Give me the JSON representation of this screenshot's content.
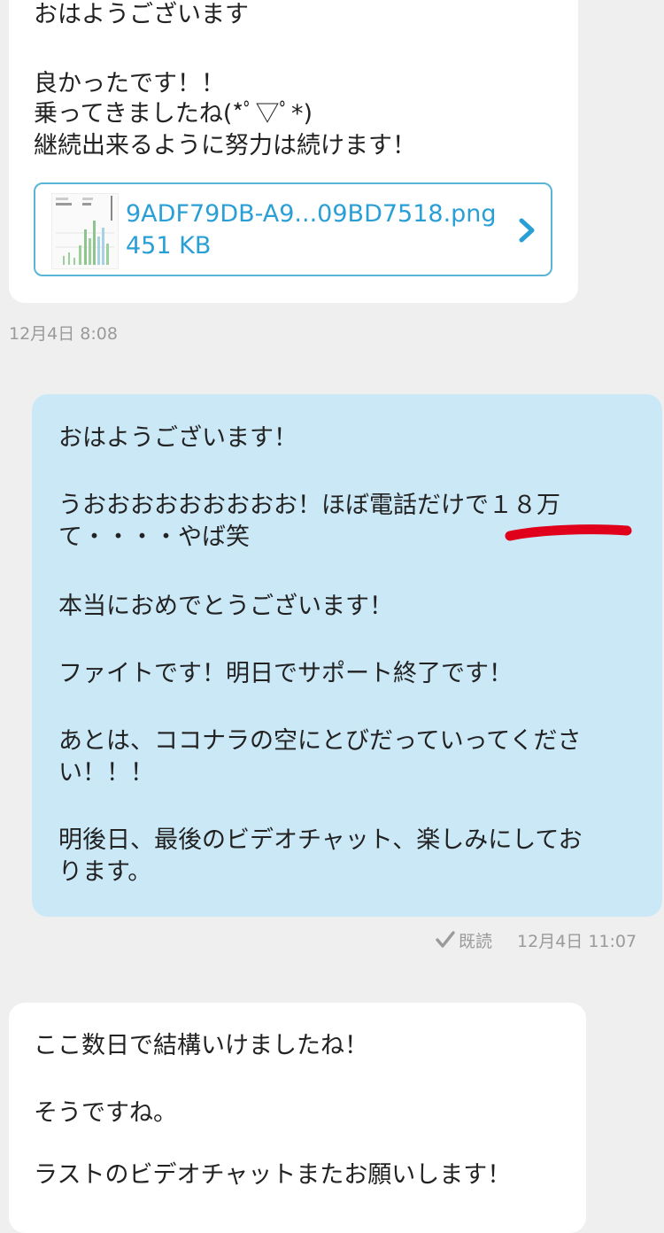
{
  "messages": [
    {
      "direction": "received",
      "lines": [
        "おはようございます",
        "",
        "良かったです！！",
        "乗ってきましたね(*ﾟ▽ﾟ*)",
        "継続出来るように努力は続けます！"
      ],
      "attachment": {
        "filename": "9ADF79DB-A9...09BD7518.png",
        "size": "451 KB",
        "icon": "chevron-right-icon"
      },
      "timestamp": "12月4日 8:08"
    },
    {
      "direction": "sent",
      "lines": [
        "おはようございます！",
        "",
        "うおおおおおおおおお！ほぼ電話だけで１８万",
        "て・・・・やば笑",
        "",
        "本当におめでとうございます！",
        "",
        "ファイトです！明日でサポート終了です！",
        "",
        "あとは、ココナラの空にとびだっていってくださ",
        "い！！！",
        "",
        "明後日、最後のビデオチャット、楽しみにしてお",
        "ります。"
      ],
      "read_label": "既読",
      "timestamp": "12月4日 11:07"
    },
    {
      "direction": "received",
      "lines": [
        "ここ数日で結構いけましたね！",
        "",
        "そうですね。",
        "",
        "ラストのビデオチャットまたお願いします！"
      ]
    }
  ],
  "colors": {
    "background": "#efefef",
    "received_bubble": "#ffffff",
    "sent_bubble": "#cbe8f7",
    "link": "#2a9fd6",
    "annotation_red": "#e0001b"
  }
}
